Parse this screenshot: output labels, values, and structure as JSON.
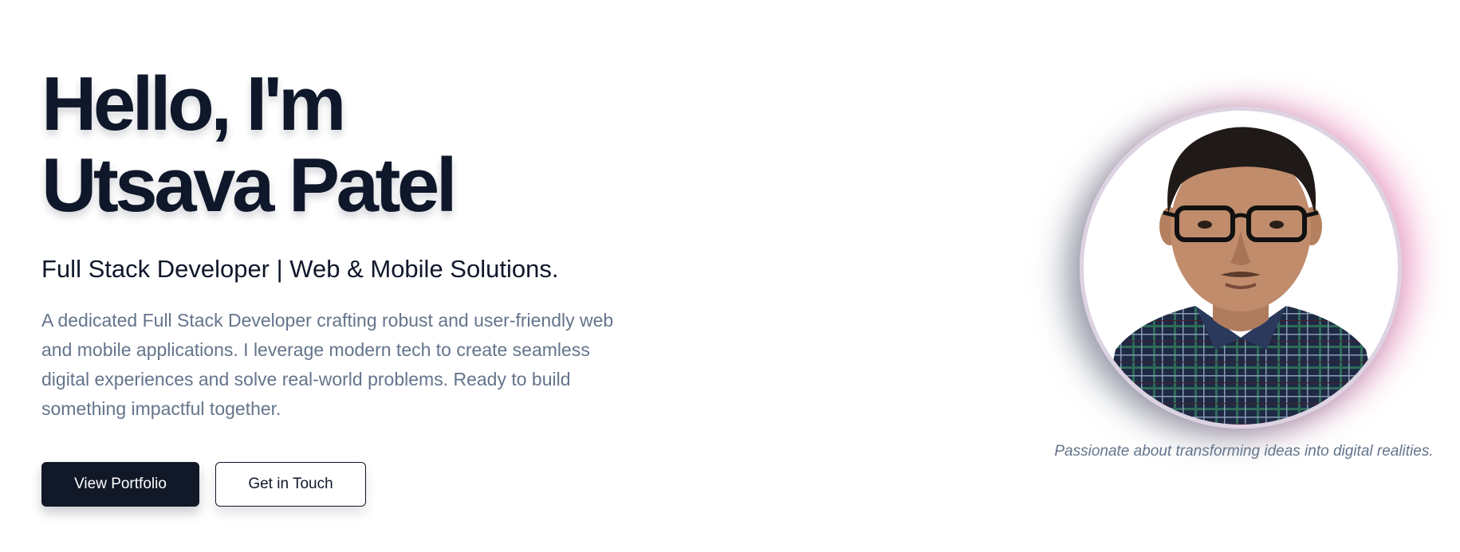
{
  "hero": {
    "greeting_line": "Hello, I'm",
    "name_line": "Utsava Patel",
    "subtitle": "Full Stack Developer | Web & Mobile Solutions.",
    "description": "A dedicated Full Stack Developer crafting robust and user-friendly web and mobile applications. I leverage modern tech to create seamless digital experiences and solve real-world problems. Ready to build something impactful together.",
    "primary_button": "View Portfolio",
    "secondary_button": "Get in Touch"
  },
  "profile": {
    "photo_alt": "Utsava Patel",
    "caption": "Passionate about transforming ideas into digital realities."
  },
  "colors": {
    "heading": "#0f172a",
    "body_text": "#64748b",
    "primary_button_bg": "#111827",
    "glow_pink": "#ec4899",
    "glow_slate": "#475569"
  }
}
